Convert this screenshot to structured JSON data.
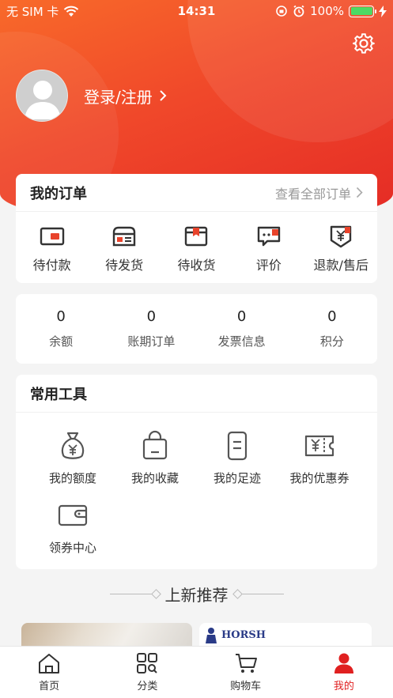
{
  "status_bar": {
    "carrier": "无 SIM 卡",
    "time": "14:31",
    "battery": "100%"
  },
  "profile": {
    "login_label": "登录/注册"
  },
  "orders": {
    "title": "我的订单",
    "view_all": "查看全部订单",
    "items": [
      {
        "label": "待付款",
        "icon": "wallet-icon"
      },
      {
        "label": "待发货",
        "icon": "box-icon"
      },
      {
        "label": "待收货",
        "icon": "package-icon"
      },
      {
        "label": "评价",
        "icon": "comment-icon"
      },
      {
        "label": "退款/售后",
        "icon": "refund-icon"
      }
    ]
  },
  "stats": [
    {
      "value": "0",
      "label": "余额"
    },
    {
      "value": "0",
      "label": "账期订单"
    },
    {
      "value": "0",
      "label": "发票信息"
    },
    {
      "value": "0",
      "label": "积分"
    }
  ],
  "tools": {
    "title": "常用工具",
    "items": [
      {
        "label": "我的额度",
        "icon": "money-bag-icon"
      },
      {
        "label": "我的收藏",
        "icon": "shopping-bag-icon"
      },
      {
        "label": "我的足迹",
        "icon": "footprint-icon"
      },
      {
        "label": "我的优惠券",
        "icon": "coupon-icon"
      },
      {
        "label": "领券中心",
        "icon": "coupon-wallet-icon"
      }
    ]
  },
  "recommend": {
    "title": "上新推荐",
    "brand_text": "HORSH"
  },
  "tabbar": [
    {
      "label": "首页",
      "icon": "home-icon"
    },
    {
      "label": "分类",
      "icon": "category-icon"
    },
    {
      "label": "购物车",
      "icon": "cart-icon"
    },
    {
      "label": "我的",
      "icon": "user-icon",
      "active": true
    }
  ],
  "colors": {
    "accent": "#e02020",
    "header_start": "#f86a2a",
    "header_end": "#e42a25",
    "battery": "#4cd964"
  }
}
